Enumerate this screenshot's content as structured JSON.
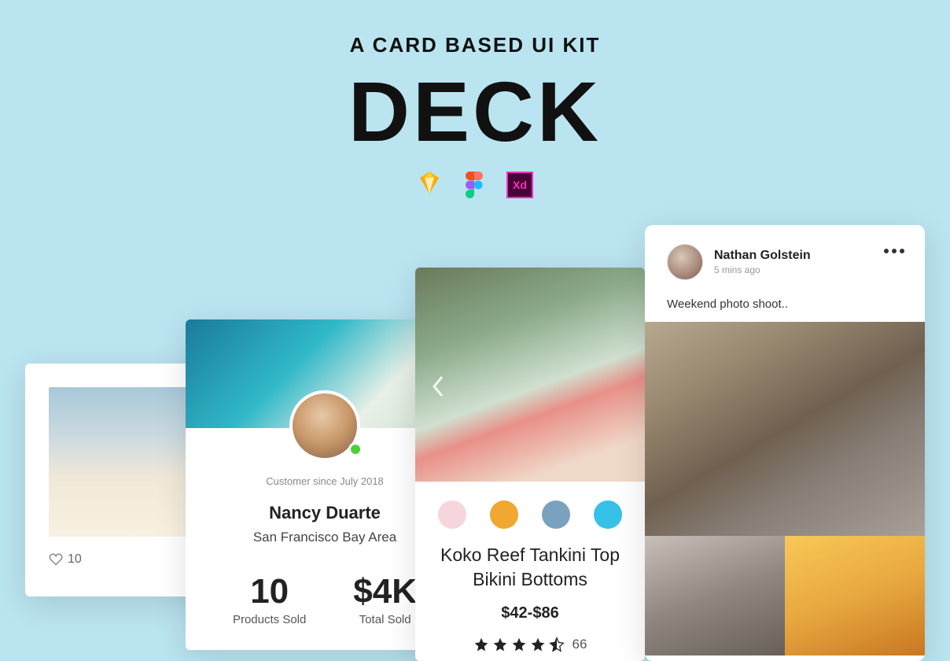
{
  "header": {
    "subtitle": "A CARD BASED UI KIT",
    "title": "DECK",
    "tools": {
      "xd": "Xd"
    }
  },
  "card1": {
    "likes": "10"
  },
  "card2": {
    "since": "Customer since July 2018",
    "name": "Nancy Duarte",
    "location": "San Francisco Bay Area",
    "stats": [
      {
        "value": "10",
        "label": "Products Sold"
      },
      {
        "value": "$4K",
        "label": "Total Sold"
      }
    ]
  },
  "card3": {
    "swatch_colors": [
      "#f6d5dd",
      "#f0a830",
      "#7aa1bd",
      "#35c2e6"
    ],
    "product_name": "Koko Reef Tankini Top Bikini Bottoms",
    "price": "$42-$86",
    "rating": 4.5,
    "review_count": "66"
  },
  "card4": {
    "author": "Nathan Golstein",
    "time": "5 mins ago",
    "caption": "Weekend photo shoot.."
  }
}
